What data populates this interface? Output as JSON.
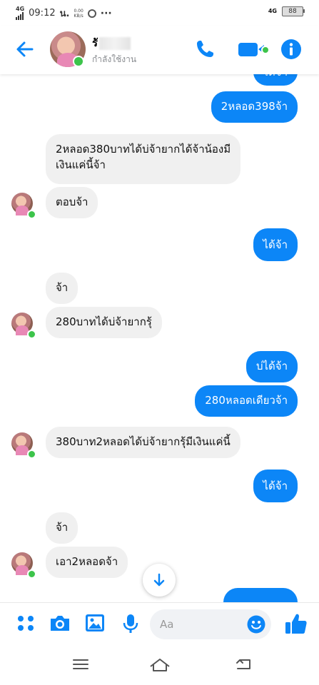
{
  "status_bar": {
    "network": "4G",
    "time": "09:12",
    "carrier_mark": "น.",
    "speed_value": "0.00",
    "speed_unit": "KB/s",
    "more": "···",
    "network_right": "4G",
    "battery": "88"
  },
  "header": {
    "contact_name": "รั",
    "contact_status": "กำลังใช้งาน"
  },
  "messages": [
    {
      "side": "out",
      "text": "ได้จ้า"
    },
    {
      "side": "out",
      "text": "2หลอด398จ้า"
    },
    {
      "side": "in",
      "text_line1": "2หลอด380บาทได้บ่จ้ายากได้จ้าน้องมี",
      "text_line2": "เงินแค่นี้จ้า"
    },
    {
      "side": "in",
      "text": "ตอบจ้า"
    },
    {
      "side": "out",
      "text": "ได้จ้า"
    },
    {
      "side": "in",
      "text": "จ้า"
    },
    {
      "side": "in",
      "text": "280บาทได้บ่จ้ายากรุ้"
    },
    {
      "side": "out",
      "text": "บ่ได้จ้า"
    },
    {
      "side": "out",
      "text": "280หลอดเดียวจ้า"
    },
    {
      "side": "in",
      "text": "380บาท2หลอดได้บ่จ้ายากรุ้มีเงินแค่นี้"
    },
    {
      "side": "out",
      "text": "ได้จ้า"
    },
    {
      "side": "in",
      "text": "จ้า"
    },
    {
      "side": "in",
      "text": "เอา2หลอดจ้า"
    }
  ],
  "composer": {
    "placeholder": "Aa"
  },
  "colors": {
    "accent": "#0c86f7",
    "incoming_bubble": "#f0f0f0",
    "online": "#3dc44b"
  },
  "icons": [
    "back-arrow-icon",
    "phone-icon",
    "video-call-icon",
    "info-icon",
    "apps-icon",
    "camera-icon",
    "gallery-icon",
    "microphone-icon",
    "emoji-icon",
    "like-icon",
    "scroll-down-icon",
    "menu-icon",
    "home-icon",
    "back-icon"
  ]
}
